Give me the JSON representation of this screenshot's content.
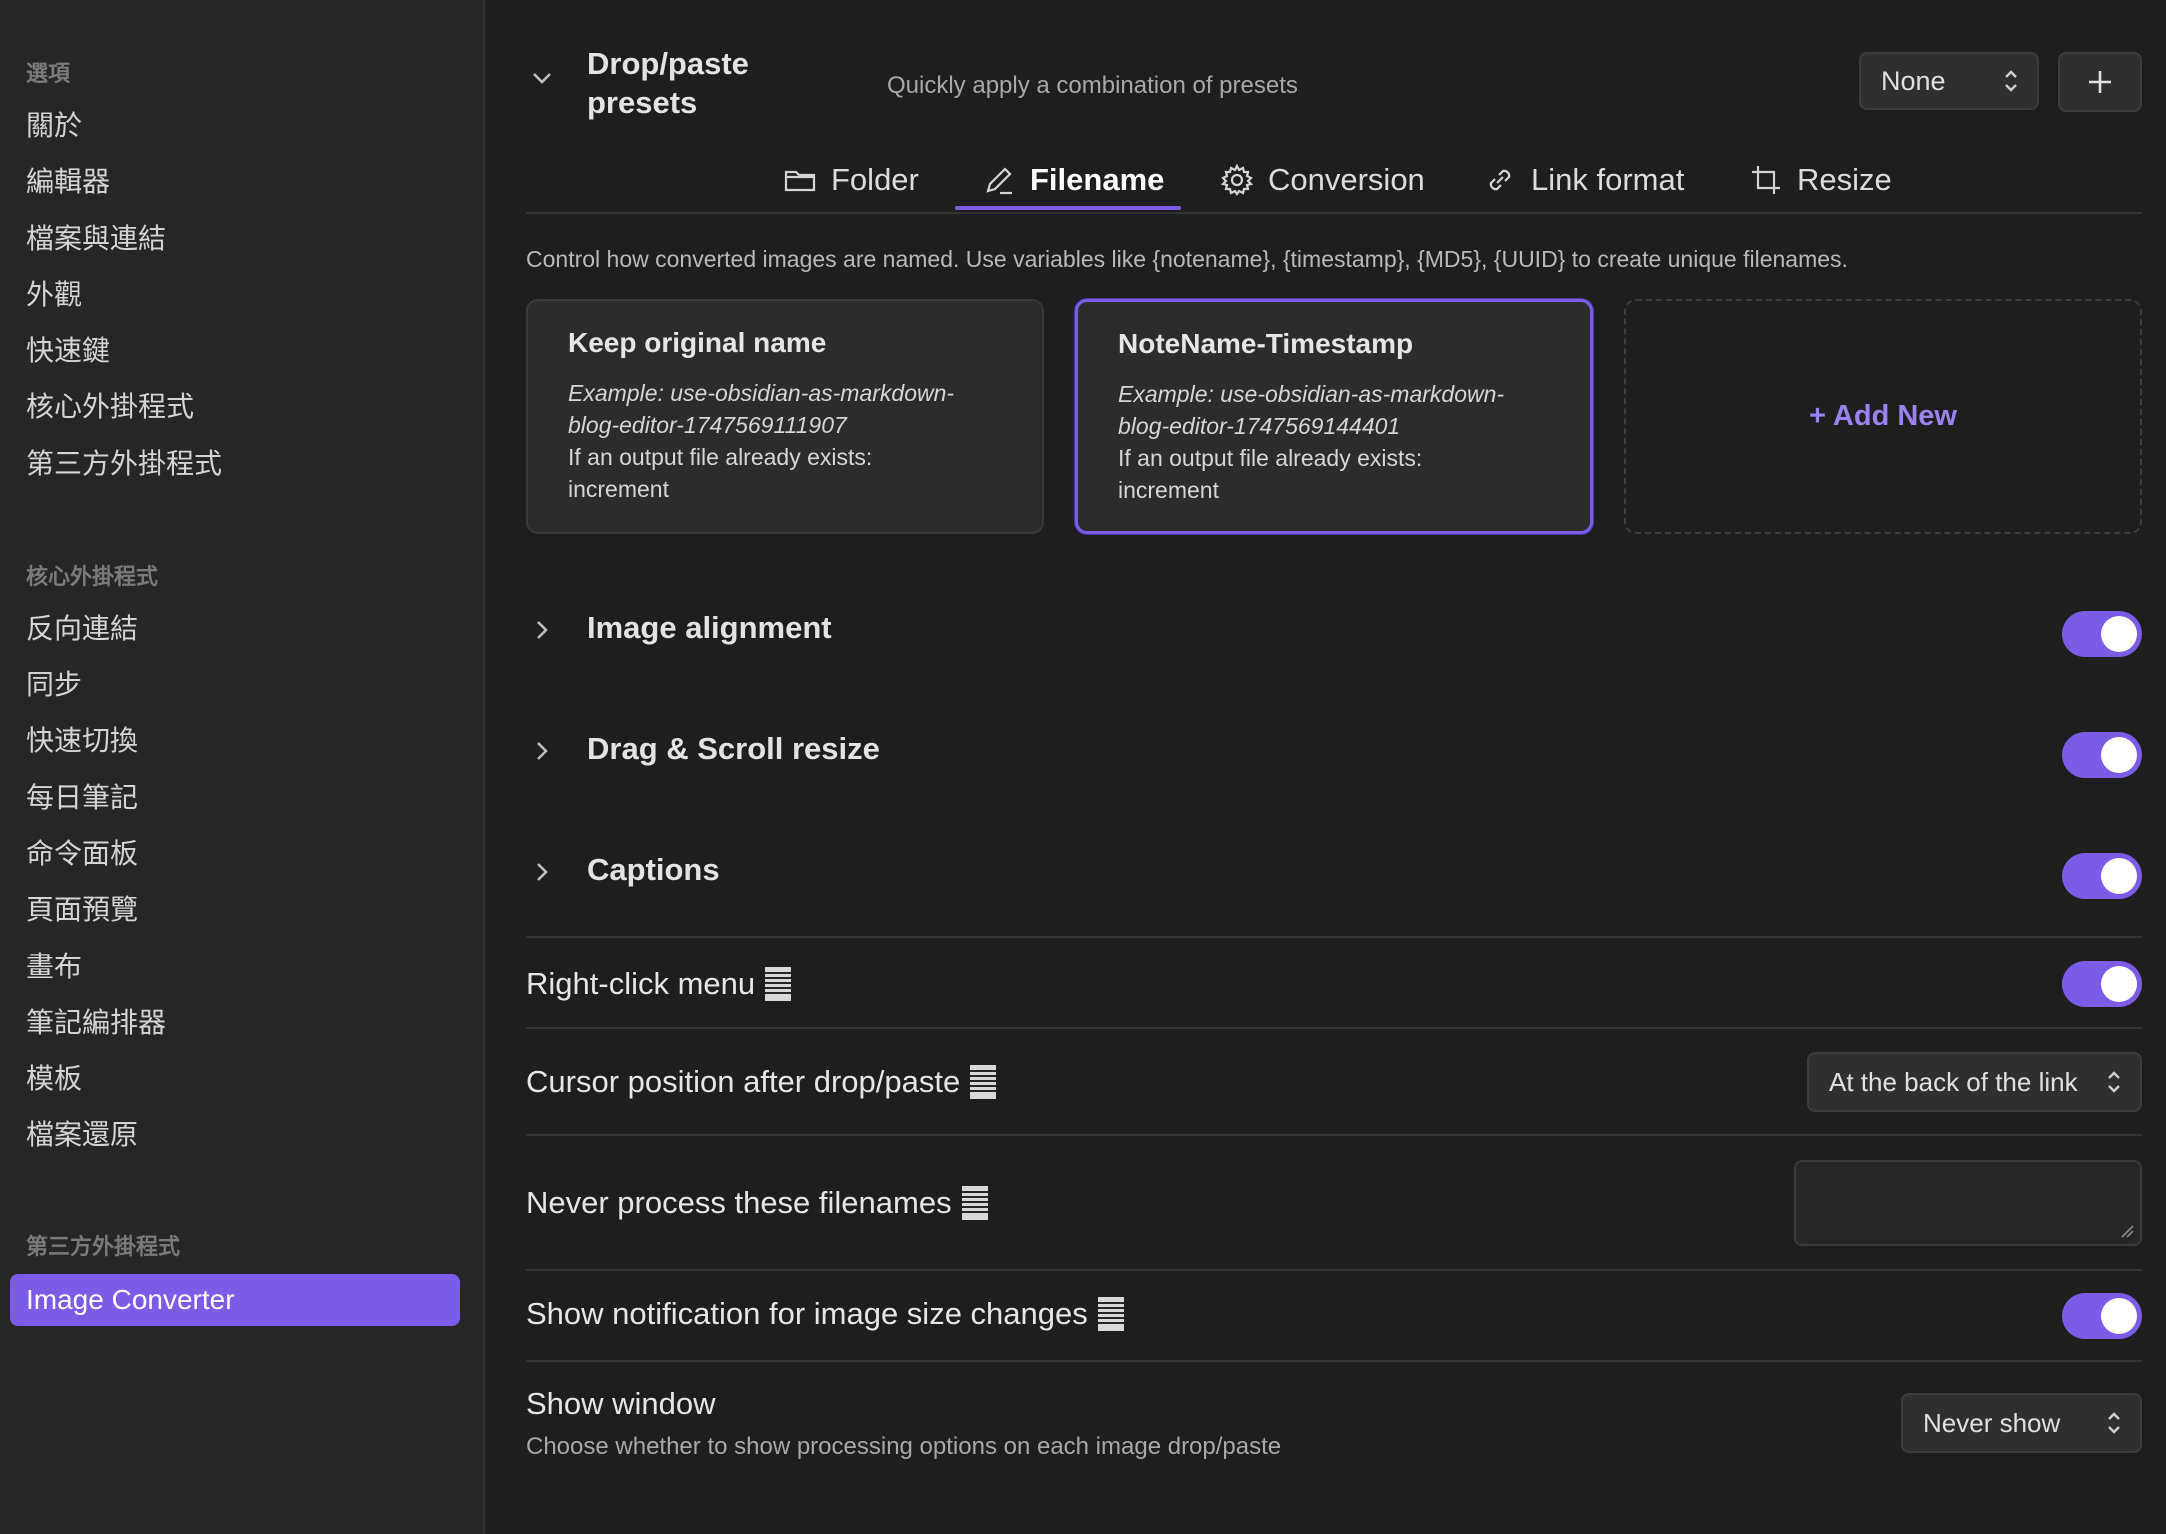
{
  "sidebar": {
    "options_header": "選項",
    "options_items": [
      "關於",
      "編輯器",
      "檔案與連結",
      "外觀",
      "快速鍵",
      "核心外掛程式",
      "第三方外掛程式"
    ],
    "core_header": "核心外掛程式",
    "core_items": [
      "反向連結",
      "同步",
      "快速切換",
      "每日筆記",
      "命令面板",
      "頁面預覽",
      "畫布",
      "筆記編排器",
      "模板",
      "檔案還原"
    ],
    "third_header": "第三方外掛程式",
    "third_active": "Image Converter"
  },
  "presets": {
    "title_line1": "Drop/paste",
    "title_line2": "presets",
    "description": "Quickly apply a combination of presets",
    "select_value": "None"
  },
  "tabs": [
    "Folder",
    "Filename",
    "Conversion",
    "Link format",
    "Resize"
  ],
  "active_tab": "Filename",
  "filename_description": "Control how converted images are named. Use variables like {notename}, {timestamp}, {MD5}, {UUID} to create unique filenames.",
  "cards": [
    {
      "title": "Keep original name",
      "example_line1": "Example: use-obsidian-as-markdown-",
      "example_line2": "blog-editor-1747569111907",
      "note_line1": "If an output file already exists:",
      "note_line2": "increment"
    },
    {
      "title": "NoteName-Timestamp",
      "example_line1": "Example: use-obsidian-as-markdown-",
      "example_line2": "blog-editor-1747569144401",
      "note_line1": "If an output file already exists:",
      "note_line2": "increment"
    }
  ],
  "add_new_label": "+ Add New",
  "sections": [
    "Image alignment",
    "Drag & Scroll resize",
    "Captions"
  ],
  "settings": {
    "right_click_menu": "Right-click menu",
    "cursor_position": "Cursor position after drop/paste",
    "cursor_value": "At the back of the link",
    "never_process": "Never process these filenames",
    "show_notification": "Show notification for image size changes",
    "show_window": "Show window",
    "show_window_desc": "Choose whether to show processing options on each image drop/paste",
    "show_window_value": "Never show"
  },
  "colors": {
    "accent": "#7c5ce6",
    "background": "#1e1e1e",
    "sidebar_bg": "#262626"
  }
}
